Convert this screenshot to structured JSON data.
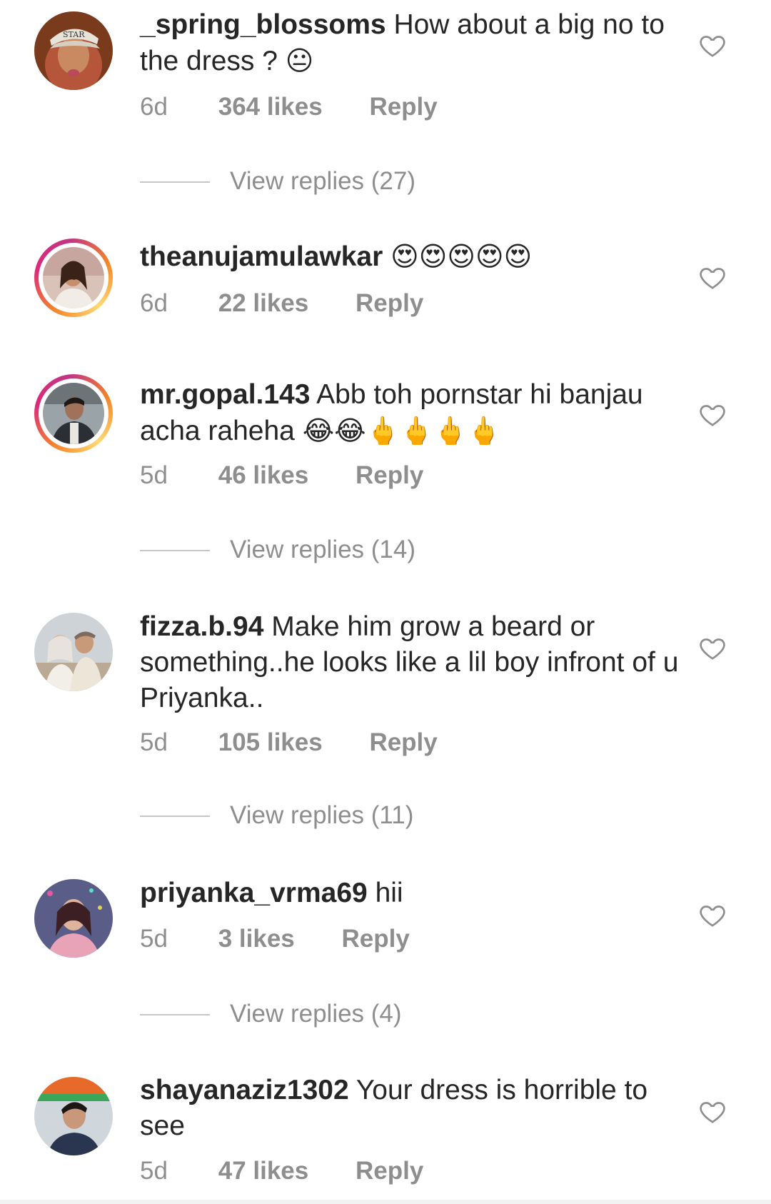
{
  "comments": [
    {
      "username": "_spring_blossoms",
      "text": "How about a big no to the dress ?",
      "emoji": "😐",
      "time": "6d",
      "likes": "364 likes",
      "reply_label": "Reply",
      "view_replies": "View replies (27)",
      "avatar_text": "STAR"
    },
    {
      "username": "theanujamulawkar",
      "text": "",
      "emoji": "😍😍😍😍😍",
      "time": "6d",
      "likes": "22 likes",
      "reply_label": "Reply"
    },
    {
      "username": "mr.gopal.143",
      "text": "Abb toh pornstar hi banjau acha raheha",
      "emoji": "😂😂🖕🖕🖕🖕",
      "time": "5d",
      "likes": "46 likes",
      "reply_label": "Reply",
      "view_replies": "View replies (14)"
    },
    {
      "username": "fizza.b.94",
      "text": "Make him grow a beard or something..he looks like a lil boy infront of u Priyanka..",
      "emoji": "",
      "time": "5d",
      "likes": "105 likes",
      "reply_label": "Reply",
      "view_replies": "View replies (11)"
    },
    {
      "username": "priyanka_vrma69",
      "text": "hii",
      "emoji": "",
      "time": "5d",
      "likes": "3 likes",
      "reply_label": "Reply",
      "view_replies": "View replies (4)"
    },
    {
      "username": "shayanaziz1302",
      "text": "Your dress is horrible to see",
      "emoji": "",
      "time": "5d",
      "likes": "47 likes",
      "reply_label": "Reply"
    }
  ],
  "colors": {
    "text": "#262626",
    "muted": "#8e8e8e",
    "story_ring_start": "#f58529",
    "story_ring_end": "#dd2a7b"
  },
  "icons": {
    "like": "heart-outline-icon"
  }
}
